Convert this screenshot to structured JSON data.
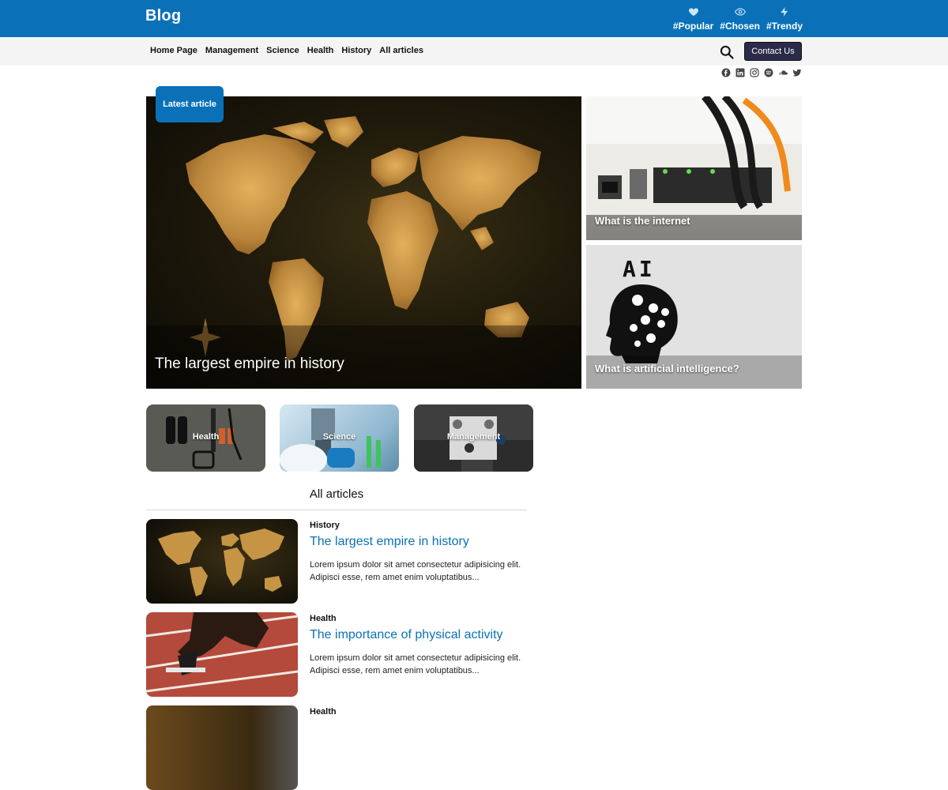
{
  "header": {
    "logo": "Blog",
    "tags": [
      {
        "label": "#Popular",
        "icon": "heart-icon"
      },
      {
        "label": "#Chosen",
        "icon": "eye-icon"
      },
      {
        "label": "#Trendy",
        "icon": "bolt-icon"
      }
    ]
  },
  "nav": {
    "items": [
      "Home Page",
      "Management",
      "Science",
      "Health",
      "History",
      "All articles"
    ],
    "contact": "Contact Us"
  },
  "social": [
    "facebook-icon",
    "linkedin-icon",
    "instagram-icon",
    "spotify-icon",
    "soundcloud-icon",
    "twitter-icon"
  ],
  "featured": {
    "badge": "Latest article",
    "main_title": "The largest empire in history",
    "side": [
      {
        "title": "What is the internet"
      },
      {
        "title": "What is artificial intelligence?",
        "image_text": "AI"
      }
    ]
  },
  "categories": [
    {
      "label": "Health"
    },
    {
      "label": "Science"
    },
    {
      "label": "Management"
    }
  ],
  "articles_section": {
    "title": "All articles",
    "items": [
      {
        "category": "History",
        "title": "The largest empire in history",
        "excerpt": "Lorem ipsum dolor sit amet consectetur adipisicing elit. Adipisci esse, rem amet enim voluptatibus..."
      },
      {
        "category": "Health",
        "title": "The importance of physical activity",
        "excerpt": "Lorem ipsum dolor sit amet consectetur adipisicing elit. Adipisci esse, rem amet enim voluptatibus..."
      },
      {
        "category": "Health"
      }
    ]
  },
  "colors": {
    "brand": "#0a71b8",
    "contact_button": "#2a2a4a",
    "nav_bg": "#f4f4f4"
  }
}
